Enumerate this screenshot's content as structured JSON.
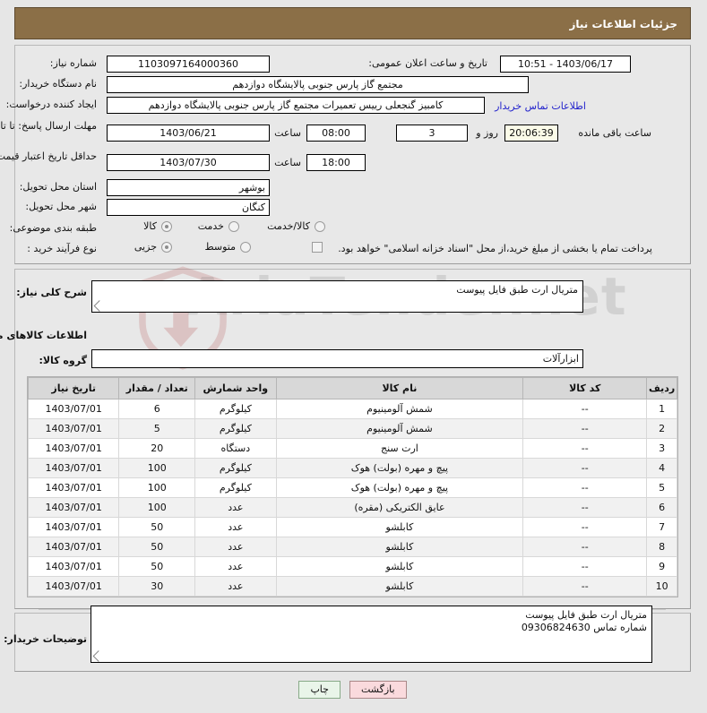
{
  "header": {
    "title": "جزئیات اطلاعات نیاز",
    "bar_color": "#8b6f47"
  },
  "watermark": {
    "text": "AriaTender.net"
  },
  "top_form": {
    "need_number_label": "شماره نیاز:",
    "need_number_value": "1103097164000360",
    "announce_label": "تاریخ و ساعت اعلان عمومی:",
    "announce_value": "1403/06/17 - 10:51",
    "buyer_org_label": "نام دستگاه خریدار:",
    "buyer_org_value": "مجتمع گاز پارس جنوبی  پالایشگاه دوازدهم",
    "buyer_org_value2": "",
    "creator_label": "ایجاد کننده درخواست:",
    "creator_value": "کامبیز گنجعلی رییس تعمیرات مجتمع گاز پارس جنوبی  پالایشگاه دوازدهم",
    "contact_link": "اطلاعات تماس خریدار",
    "reply_deadline_label": "مهلت ارسال پاسخ: تا تاریخ:",
    "reply_deadline_date": "1403/06/21",
    "hour_label": "ساعت",
    "reply_deadline_time": "08:00",
    "days_value": "3",
    "days_and_label": "روز و",
    "countdown_value": "20:06:39",
    "remaining_label": "ساعت باقی مانده",
    "price_validity_label": "حداقل تاریخ اعتبار قیمت: تا تاریخ:",
    "price_validity_date": "1403/07/30",
    "price_validity_time": "18:00",
    "province_label": "استان محل تحویل:",
    "province_value": "بوشهر",
    "city_label": "شهر محل تحویل:",
    "city_value": "کنگان",
    "category_label": "طبقه بندی موضوعی:",
    "category_options": [
      {
        "label": "کالا",
        "selected": true
      },
      {
        "label": "خدمت",
        "selected": false
      },
      {
        "label": "کالا/خدمت",
        "selected": false
      }
    ],
    "process_label": "نوع فرآیند خرید :",
    "process_options": [
      {
        "label": "جزیی",
        "selected": true
      },
      {
        "label": "متوسط",
        "selected": false
      }
    ],
    "treasury_checkbox_label": "پرداخت تمام یا بخشی از مبلغ خرید،از محل \"اسناد خزانه اسلامی\" خواهد بود.",
    "treasury_checked": false
  },
  "middle": {
    "general_desc_label": "شرح کلی نیاز:",
    "general_desc_value": "متریال ارت طبق فایل پیوست",
    "goods_info_title": "اطلاعات کالاهای مورد نیاز",
    "goods_group_label": "گروه کالا:",
    "goods_group_value": "ابزارآلات"
  },
  "table": {
    "columns": [
      "ردیف",
      "کد کالا",
      "نام کالا",
      "واحد شمارش",
      "تعداد / مقدار",
      "تاریخ نیاز"
    ],
    "rows": [
      {
        "radif": "1",
        "code": "--",
        "name": "شمش آلومینیوم",
        "unit": "کیلوگرم",
        "qty": "6",
        "date": "1403/07/01"
      },
      {
        "radif": "2",
        "code": "--",
        "name": "شمش آلومینیوم",
        "unit": "کیلوگرم",
        "qty": "5",
        "date": "1403/07/01"
      },
      {
        "radif": "3",
        "code": "--",
        "name": "ارت سنج",
        "unit": "دستگاه",
        "qty": "20",
        "date": "1403/07/01"
      },
      {
        "radif": "4",
        "code": "--",
        "name": "پیچ و مهره (بولت) هوک",
        "unit": "کیلوگرم",
        "qty": "100",
        "date": "1403/07/01"
      },
      {
        "radif": "5",
        "code": "--",
        "name": "پیچ و مهره (بولت) هوک",
        "unit": "کیلوگرم",
        "qty": "100",
        "date": "1403/07/01"
      },
      {
        "radif": "6",
        "code": "--",
        "name": "عایق الکتریکی (مقره)",
        "unit": "عدد",
        "qty": "100",
        "date": "1403/07/01"
      },
      {
        "radif": "7",
        "code": "--",
        "name": "کابلشو",
        "unit": "عدد",
        "qty": "50",
        "date": "1403/07/01"
      },
      {
        "radif": "8",
        "code": "--",
        "name": "کابلشو",
        "unit": "عدد",
        "qty": "50",
        "date": "1403/07/01"
      },
      {
        "radif": "9",
        "code": "--",
        "name": "کابلشو",
        "unit": "عدد",
        "qty": "50",
        "date": "1403/07/01"
      },
      {
        "radif": "10",
        "code": "--",
        "name": "کابلشو",
        "unit": "عدد",
        "qty": "30",
        "date": "1403/07/01"
      }
    ]
  },
  "bottom": {
    "buyer_notes_label": "توضیحات خریدار:",
    "buyer_notes_value": "متریال ارت طبق فایل پیوست\nشماره تماس 09306824630"
  },
  "buttons": {
    "back_label": "بازگشت",
    "print_label": "چاپ",
    "back_color": "#fadadd",
    "print_color": "#e9f5e9"
  }
}
